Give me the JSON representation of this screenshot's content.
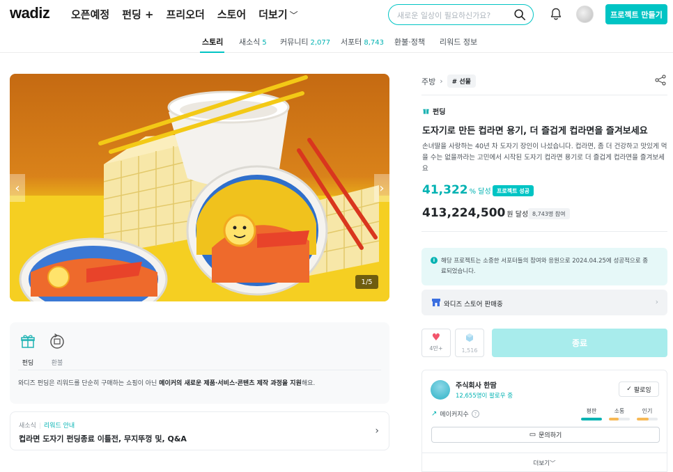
{
  "header": {
    "logo": "wadiz",
    "nav": [
      "오픈예정",
      "펀딩 +",
      "프리오더",
      "스토어",
      "더보기"
    ],
    "search_placeholder": "새로운 일상이 필요하신가요?",
    "create_button": "프로젝트 만들기"
  },
  "tabs": [
    {
      "label": "스토리",
      "count": "",
      "active": true
    },
    {
      "label": "새소식",
      "count": "5"
    },
    {
      "label": "커뮤니티",
      "count": "2,077"
    },
    {
      "label": "서포터",
      "count": "8,743"
    },
    {
      "label": "환불·정책",
      "count": ""
    },
    {
      "label": "리워드 정보",
      "count": ""
    }
  ],
  "hero": {
    "counter": "1/5"
  },
  "info_card": {
    "items": [
      {
        "label": "펀딩"
      },
      {
        "label": "환불"
      }
    ],
    "text_prefix": "와디즈 펀딩은 리워드를 단순히 구매하는 쇼핑이 아닌 ",
    "text_bold": "메이커의 새로운 제품·서비스·콘텐츠 제작 과정을 지원",
    "text_suffix": "해요."
  },
  "news": {
    "tag": "새소식",
    "category": "리워드 안내",
    "title": "컵라면 도자기 펀딩종료 이틀전, 무지뚜껑 및, Q&A"
  },
  "project": {
    "breadcrumb_category": "주방",
    "breadcrumb_tag": "# 선물",
    "type_label": "펀딩",
    "title": "도자기로 만든 컵라면 용기, 더 즐겁게 컵라면을 즐겨보세요",
    "description": "손녀딸을 사랑하는 40년 차 도자기 장인이 나섰습니다. 컵라면, 좀 더 건강하고 맛있게 먹을 수는 없을까라는 고민에서 시작된 도자기 컵라면 용기로 더 즐겁게 컵라면을 즐겨보세요",
    "percent": "41,322",
    "percent_unit": "% 달성",
    "success_badge": "프로젝트 성공",
    "amount": "413,224,500",
    "amount_unit": "원 달성",
    "supporters": "8,743명 참여",
    "notice": "해당 프로젝트는 소중한 서포터들의 참여와 응원으로 2024.04.25에 성공적으로 종료되었습니다.",
    "store_text": "와디즈 스토어 판매중",
    "like_count": "4만+",
    "share_count": "1,516",
    "end_button": "종료"
  },
  "maker": {
    "name": "주식회사 한땀",
    "followers": "12,655명이 팔로우 중",
    "follow_button": "팔로잉",
    "index_label": "메이커지수",
    "metrics": [
      {
        "label": "평판",
        "value": 1.0,
        "color": "#00b2b2"
      },
      {
        "label": "소통",
        "value": 0.45,
        "color": "#f7b955"
      },
      {
        "label": "인기",
        "value": 0.55,
        "color": "#f7b955"
      }
    ],
    "inquiry_button": "문의하기",
    "more": "더보기"
  },
  "colors": {
    "accent": "#00c4c4",
    "accent_dark": "#00b2b2",
    "end_button": "#a8ecec",
    "like": "#f2556c"
  }
}
